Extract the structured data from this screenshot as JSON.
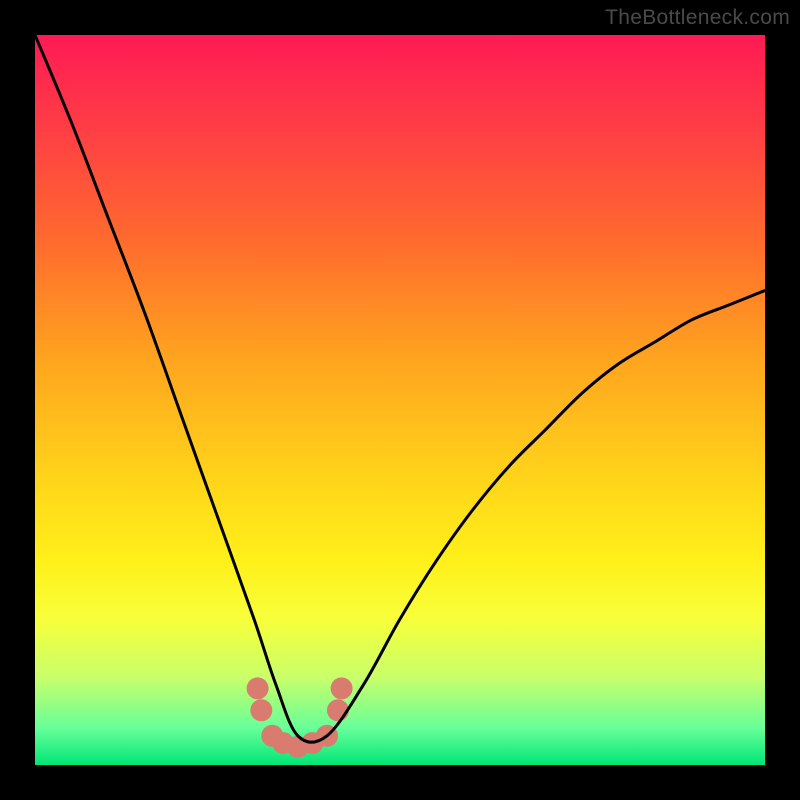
{
  "watermark": "TheBottleneck.com",
  "chart_data": {
    "type": "line",
    "title": "",
    "xlabel": "",
    "ylabel": "",
    "xlim": [
      0,
      100
    ],
    "ylim": [
      0,
      100
    ],
    "grid": false,
    "legend": false,
    "series": [
      {
        "name": "bottleneck-curve",
        "x": [
          0,
          5,
          10,
          15,
          20,
          25,
          30,
          33,
          36,
          40,
          45,
          50,
          55,
          60,
          65,
          70,
          75,
          80,
          85,
          90,
          95,
          100
        ],
        "values": [
          100,
          88,
          75,
          62,
          48,
          34,
          20,
          11,
          4,
          4,
          11,
          20,
          28,
          35,
          41,
          46,
          51,
          55,
          58,
          61,
          63,
          65
        ]
      }
    ],
    "markers": {
      "name": "salmon-markers",
      "color": "#d97b6f",
      "points": [
        {
          "x": 30.5,
          "y": 10.5
        },
        {
          "x": 31.0,
          "y": 7.5
        },
        {
          "x": 32.5,
          "y": 4.0
        },
        {
          "x": 34.0,
          "y": 3.0
        },
        {
          "x": 36.0,
          "y": 2.5
        },
        {
          "x": 38.0,
          "y": 3.0
        },
        {
          "x": 40.0,
          "y": 4.0
        },
        {
          "x": 41.5,
          "y": 7.5
        },
        {
          "x": 42.0,
          "y": 10.5
        }
      ],
      "radius": 11
    },
    "background_gradient": {
      "top": "#ff1a54",
      "mid": "#fff01a",
      "bottom": "#00e676"
    }
  }
}
